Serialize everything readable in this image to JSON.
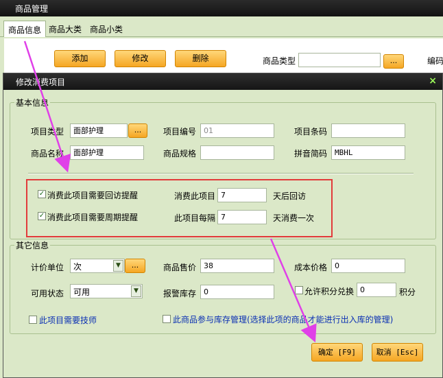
{
  "outer": {
    "title": "商品管理",
    "tabs": [
      "商品信息",
      "商品大类",
      "商品小类"
    ],
    "buttons": {
      "add": "添加",
      "edit": "修改",
      "delete": "删除"
    },
    "type_label": "商品类型",
    "type_value": "",
    "dots": "...",
    "code_label": "编码"
  },
  "dialog": {
    "title": "修改消费项目",
    "close": "×",
    "basic": {
      "group_title": "基本信息",
      "item_type_label": "项目类型",
      "item_type_value": "面部护理",
      "item_code_label": "项目编号",
      "item_code_value": "01",
      "barcode_label": "项目条码",
      "barcode_value": "",
      "name_label": "商品名称",
      "name_value": "面部护理",
      "spec_label": "商品规格",
      "spec_value": "",
      "pinyin_label": "拼音简码",
      "pinyin_value": "MBHL",
      "dots": "..."
    },
    "reminders": {
      "revisit_check_label": "消费此项目需要回访提醒",
      "revisit_checked": true,
      "revisit_prefix": "消费此项目",
      "revisit_value": "7",
      "revisit_suffix": "天后回访",
      "period_check_label": "消费此项目需要周期提醒",
      "period_checked": true,
      "period_prefix": "此项目每隔",
      "period_value": "7",
      "period_suffix": "天消费一次"
    },
    "other": {
      "group_title": "其它信息",
      "unit_label": "计价单位",
      "unit_value": "次",
      "price_label": "商品售价",
      "price_value": "38",
      "cost_label": "成本价格",
      "cost_value": "0",
      "status_label": "可用状态",
      "status_value": "可用",
      "alarm_label": "报警库存",
      "alarm_value": "0",
      "points_check_label": "允许积分兑换",
      "points_checked": false,
      "points_value": "0",
      "points_unit": "积分",
      "tech_label": "此项目需要技师",
      "tech_checked": false,
      "stock_label": "此商品参与库存管理(选择此项的商品才能进行出入库的管理)",
      "stock_checked": false,
      "dots": "..."
    },
    "footer": {
      "ok": "确定 [F9]",
      "cancel": "取消 [Esc]"
    }
  },
  "colors": {
    "accent_orange": "#f5a623",
    "highlight_red": "#e23a3a",
    "arrow_magenta": "#e040e8",
    "link_blue": "#0a2fb3"
  }
}
